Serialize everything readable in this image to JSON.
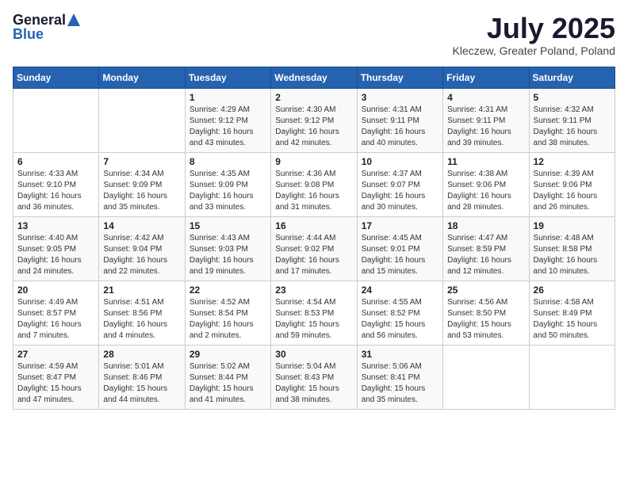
{
  "header": {
    "logo_general": "General",
    "logo_blue": "Blue",
    "month": "July 2025",
    "location": "Kleczew, Greater Poland, Poland"
  },
  "days_of_week": [
    "Sunday",
    "Monday",
    "Tuesday",
    "Wednesday",
    "Thursday",
    "Friday",
    "Saturday"
  ],
  "weeks": [
    [
      {
        "num": "",
        "info": ""
      },
      {
        "num": "",
        "info": ""
      },
      {
        "num": "1",
        "info": "Sunrise: 4:29 AM\nSunset: 9:12 PM\nDaylight: 16 hours\nand 43 minutes."
      },
      {
        "num": "2",
        "info": "Sunrise: 4:30 AM\nSunset: 9:12 PM\nDaylight: 16 hours\nand 42 minutes."
      },
      {
        "num": "3",
        "info": "Sunrise: 4:31 AM\nSunset: 9:11 PM\nDaylight: 16 hours\nand 40 minutes."
      },
      {
        "num": "4",
        "info": "Sunrise: 4:31 AM\nSunset: 9:11 PM\nDaylight: 16 hours\nand 39 minutes."
      },
      {
        "num": "5",
        "info": "Sunrise: 4:32 AM\nSunset: 9:11 PM\nDaylight: 16 hours\nand 38 minutes."
      }
    ],
    [
      {
        "num": "6",
        "info": "Sunrise: 4:33 AM\nSunset: 9:10 PM\nDaylight: 16 hours\nand 36 minutes."
      },
      {
        "num": "7",
        "info": "Sunrise: 4:34 AM\nSunset: 9:09 PM\nDaylight: 16 hours\nand 35 minutes."
      },
      {
        "num": "8",
        "info": "Sunrise: 4:35 AM\nSunset: 9:09 PM\nDaylight: 16 hours\nand 33 minutes."
      },
      {
        "num": "9",
        "info": "Sunrise: 4:36 AM\nSunset: 9:08 PM\nDaylight: 16 hours\nand 31 minutes."
      },
      {
        "num": "10",
        "info": "Sunrise: 4:37 AM\nSunset: 9:07 PM\nDaylight: 16 hours\nand 30 minutes."
      },
      {
        "num": "11",
        "info": "Sunrise: 4:38 AM\nSunset: 9:06 PM\nDaylight: 16 hours\nand 28 minutes."
      },
      {
        "num": "12",
        "info": "Sunrise: 4:39 AM\nSunset: 9:06 PM\nDaylight: 16 hours\nand 26 minutes."
      }
    ],
    [
      {
        "num": "13",
        "info": "Sunrise: 4:40 AM\nSunset: 9:05 PM\nDaylight: 16 hours\nand 24 minutes."
      },
      {
        "num": "14",
        "info": "Sunrise: 4:42 AM\nSunset: 9:04 PM\nDaylight: 16 hours\nand 22 minutes."
      },
      {
        "num": "15",
        "info": "Sunrise: 4:43 AM\nSunset: 9:03 PM\nDaylight: 16 hours\nand 19 minutes."
      },
      {
        "num": "16",
        "info": "Sunrise: 4:44 AM\nSunset: 9:02 PM\nDaylight: 16 hours\nand 17 minutes."
      },
      {
        "num": "17",
        "info": "Sunrise: 4:45 AM\nSunset: 9:01 PM\nDaylight: 16 hours\nand 15 minutes."
      },
      {
        "num": "18",
        "info": "Sunrise: 4:47 AM\nSunset: 8:59 PM\nDaylight: 16 hours\nand 12 minutes."
      },
      {
        "num": "19",
        "info": "Sunrise: 4:48 AM\nSunset: 8:58 PM\nDaylight: 16 hours\nand 10 minutes."
      }
    ],
    [
      {
        "num": "20",
        "info": "Sunrise: 4:49 AM\nSunset: 8:57 PM\nDaylight: 16 hours\nand 7 minutes."
      },
      {
        "num": "21",
        "info": "Sunrise: 4:51 AM\nSunset: 8:56 PM\nDaylight: 16 hours\nand 4 minutes."
      },
      {
        "num": "22",
        "info": "Sunrise: 4:52 AM\nSunset: 8:54 PM\nDaylight: 16 hours\nand 2 minutes."
      },
      {
        "num": "23",
        "info": "Sunrise: 4:54 AM\nSunset: 8:53 PM\nDaylight: 15 hours\nand 59 minutes."
      },
      {
        "num": "24",
        "info": "Sunrise: 4:55 AM\nSunset: 8:52 PM\nDaylight: 15 hours\nand 56 minutes."
      },
      {
        "num": "25",
        "info": "Sunrise: 4:56 AM\nSunset: 8:50 PM\nDaylight: 15 hours\nand 53 minutes."
      },
      {
        "num": "26",
        "info": "Sunrise: 4:58 AM\nSunset: 8:49 PM\nDaylight: 15 hours\nand 50 minutes."
      }
    ],
    [
      {
        "num": "27",
        "info": "Sunrise: 4:59 AM\nSunset: 8:47 PM\nDaylight: 15 hours\nand 47 minutes."
      },
      {
        "num": "28",
        "info": "Sunrise: 5:01 AM\nSunset: 8:46 PM\nDaylight: 15 hours\nand 44 minutes."
      },
      {
        "num": "29",
        "info": "Sunrise: 5:02 AM\nSunset: 8:44 PM\nDaylight: 15 hours\nand 41 minutes."
      },
      {
        "num": "30",
        "info": "Sunrise: 5:04 AM\nSunset: 8:43 PM\nDaylight: 15 hours\nand 38 minutes."
      },
      {
        "num": "31",
        "info": "Sunrise: 5:06 AM\nSunset: 8:41 PM\nDaylight: 15 hours\nand 35 minutes."
      },
      {
        "num": "",
        "info": ""
      },
      {
        "num": "",
        "info": ""
      }
    ]
  ]
}
